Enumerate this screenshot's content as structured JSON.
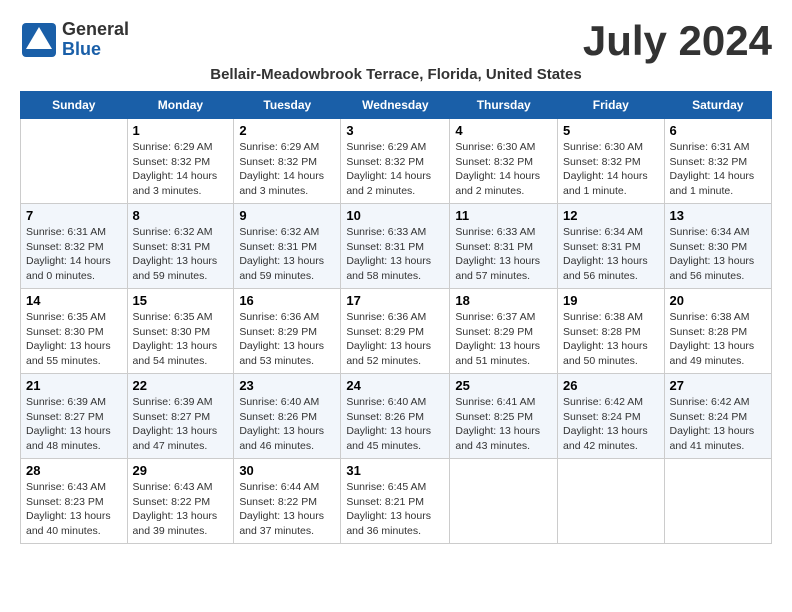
{
  "header": {
    "logo_general": "General",
    "logo_blue": "Blue",
    "month_title": "July 2024",
    "subtitle": "Bellair-Meadowbrook Terrace, Florida, United States"
  },
  "weekdays": [
    "Sunday",
    "Monday",
    "Tuesday",
    "Wednesday",
    "Thursday",
    "Friday",
    "Saturday"
  ],
  "weeks": [
    [
      {
        "day": "",
        "info": ""
      },
      {
        "day": "1",
        "info": "Sunrise: 6:29 AM\nSunset: 8:32 PM\nDaylight: 14 hours\nand 3 minutes."
      },
      {
        "day": "2",
        "info": "Sunrise: 6:29 AM\nSunset: 8:32 PM\nDaylight: 14 hours\nand 3 minutes."
      },
      {
        "day": "3",
        "info": "Sunrise: 6:29 AM\nSunset: 8:32 PM\nDaylight: 14 hours\nand 2 minutes."
      },
      {
        "day": "4",
        "info": "Sunrise: 6:30 AM\nSunset: 8:32 PM\nDaylight: 14 hours\nand 2 minutes."
      },
      {
        "day": "5",
        "info": "Sunrise: 6:30 AM\nSunset: 8:32 PM\nDaylight: 14 hours\nand 1 minute."
      },
      {
        "day": "6",
        "info": "Sunrise: 6:31 AM\nSunset: 8:32 PM\nDaylight: 14 hours\nand 1 minute."
      }
    ],
    [
      {
        "day": "7",
        "info": "Sunrise: 6:31 AM\nSunset: 8:32 PM\nDaylight: 14 hours\nand 0 minutes."
      },
      {
        "day": "8",
        "info": "Sunrise: 6:32 AM\nSunset: 8:31 PM\nDaylight: 13 hours\nand 59 minutes."
      },
      {
        "day": "9",
        "info": "Sunrise: 6:32 AM\nSunset: 8:31 PM\nDaylight: 13 hours\nand 59 minutes."
      },
      {
        "day": "10",
        "info": "Sunrise: 6:33 AM\nSunset: 8:31 PM\nDaylight: 13 hours\nand 58 minutes."
      },
      {
        "day": "11",
        "info": "Sunrise: 6:33 AM\nSunset: 8:31 PM\nDaylight: 13 hours\nand 57 minutes."
      },
      {
        "day": "12",
        "info": "Sunrise: 6:34 AM\nSunset: 8:31 PM\nDaylight: 13 hours\nand 56 minutes."
      },
      {
        "day": "13",
        "info": "Sunrise: 6:34 AM\nSunset: 8:30 PM\nDaylight: 13 hours\nand 56 minutes."
      }
    ],
    [
      {
        "day": "14",
        "info": "Sunrise: 6:35 AM\nSunset: 8:30 PM\nDaylight: 13 hours\nand 55 minutes."
      },
      {
        "day": "15",
        "info": "Sunrise: 6:35 AM\nSunset: 8:30 PM\nDaylight: 13 hours\nand 54 minutes."
      },
      {
        "day": "16",
        "info": "Sunrise: 6:36 AM\nSunset: 8:29 PM\nDaylight: 13 hours\nand 53 minutes."
      },
      {
        "day": "17",
        "info": "Sunrise: 6:36 AM\nSunset: 8:29 PM\nDaylight: 13 hours\nand 52 minutes."
      },
      {
        "day": "18",
        "info": "Sunrise: 6:37 AM\nSunset: 8:29 PM\nDaylight: 13 hours\nand 51 minutes."
      },
      {
        "day": "19",
        "info": "Sunrise: 6:38 AM\nSunset: 8:28 PM\nDaylight: 13 hours\nand 50 minutes."
      },
      {
        "day": "20",
        "info": "Sunrise: 6:38 AM\nSunset: 8:28 PM\nDaylight: 13 hours\nand 49 minutes."
      }
    ],
    [
      {
        "day": "21",
        "info": "Sunrise: 6:39 AM\nSunset: 8:27 PM\nDaylight: 13 hours\nand 48 minutes."
      },
      {
        "day": "22",
        "info": "Sunrise: 6:39 AM\nSunset: 8:27 PM\nDaylight: 13 hours\nand 47 minutes."
      },
      {
        "day": "23",
        "info": "Sunrise: 6:40 AM\nSunset: 8:26 PM\nDaylight: 13 hours\nand 46 minutes."
      },
      {
        "day": "24",
        "info": "Sunrise: 6:40 AM\nSunset: 8:26 PM\nDaylight: 13 hours\nand 45 minutes."
      },
      {
        "day": "25",
        "info": "Sunrise: 6:41 AM\nSunset: 8:25 PM\nDaylight: 13 hours\nand 43 minutes."
      },
      {
        "day": "26",
        "info": "Sunrise: 6:42 AM\nSunset: 8:24 PM\nDaylight: 13 hours\nand 42 minutes."
      },
      {
        "day": "27",
        "info": "Sunrise: 6:42 AM\nSunset: 8:24 PM\nDaylight: 13 hours\nand 41 minutes."
      }
    ],
    [
      {
        "day": "28",
        "info": "Sunrise: 6:43 AM\nSunset: 8:23 PM\nDaylight: 13 hours\nand 40 minutes."
      },
      {
        "day": "29",
        "info": "Sunrise: 6:43 AM\nSunset: 8:22 PM\nDaylight: 13 hours\nand 39 minutes."
      },
      {
        "day": "30",
        "info": "Sunrise: 6:44 AM\nSunset: 8:22 PM\nDaylight: 13 hours\nand 37 minutes."
      },
      {
        "day": "31",
        "info": "Sunrise: 6:45 AM\nSunset: 8:21 PM\nDaylight: 13 hours\nand 36 minutes."
      },
      {
        "day": "",
        "info": ""
      },
      {
        "day": "",
        "info": ""
      },
      {
        "day": "",
        "info": ""
      }
    ]
  ]
}
